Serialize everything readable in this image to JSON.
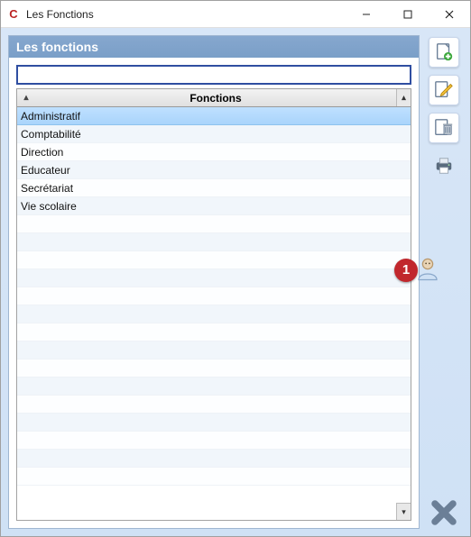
{
  "window": {
    "title": "Les Fonctions"
  },
  "panel": {
    "header": "Les fonctions"
  },
  "search": {
    "value": "",
    "placeholder": ""
  },
  "grid": {
    "column_header": "Fonctions",
    "rows": [
      "Administratif",
      "Comptabilité",
      "Direction",
      "Educateur",
      "Secrétariat",
      "Vie scolaire"
    ],
    "selected_index": 0,
    "visible_row_slots": 21
  },
  "tools": {
    "add": "add",
    "edit": "edit",
    "delete": "delete",
    "print": "print",
    "close": "close"
  },
  "callout": {
    "number": "1"
  }
}
